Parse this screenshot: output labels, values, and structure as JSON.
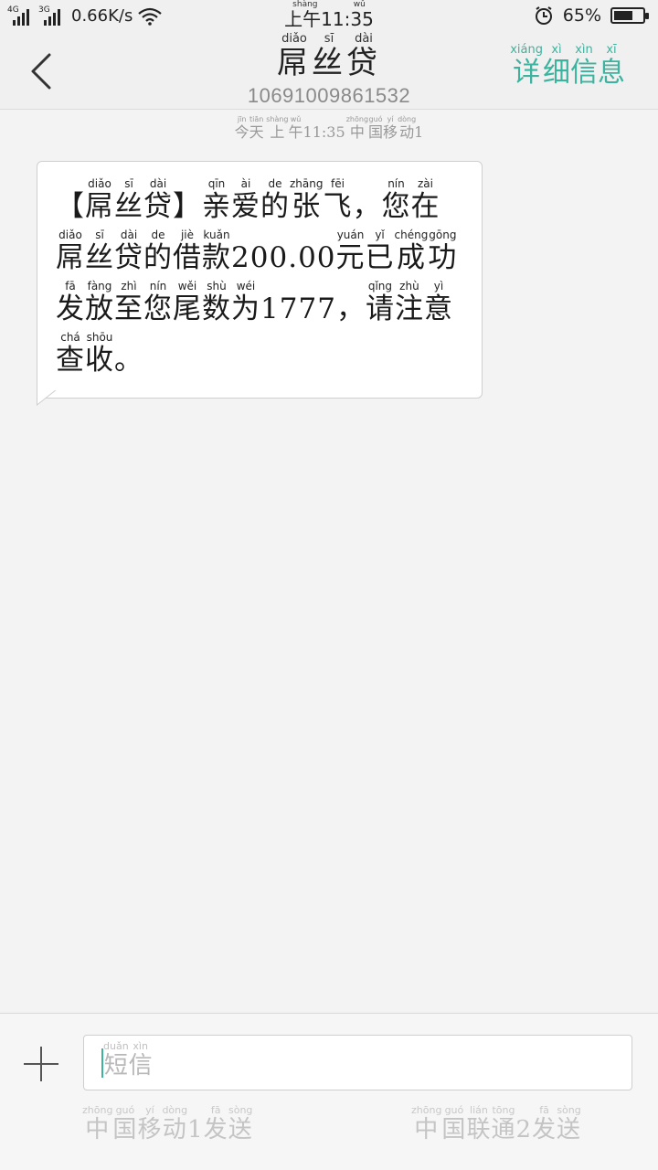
{
  "status_bar": {
    "sim1_tag": "4G",
    "sim2_tag": "3G",
    "speed": "0.66K/s",
    "time": "上午11:35",
    "time_pinyin": "shàng wǔ",
    "battery": "65%",
    "battery_level": 0.65
  },
  "header": {
    "contact_name": [
      "屌",
      "丝",
      "贷"
    ],
    "contact_pinyin": [
      "diǎo",
      "sī",
      "dài"
    ],
    "phone_number": "10691009861532",
    "details": [
      "详",
      "细",
      "信",
      "息"
    ],
    "details_pinyin": [
      "xiáng",
      "xì",
      "xìn",
      "xī"
    ]
  },
  "conversation": {
    "date_chars": [
      "今",
      "天"
    ],
    "date_pinyin": [
      "jīn",
      "tiān"
    ],
    "time_chars": [
      "上",
      "午"
    ],
    "time_pinyin": [
      "shàng",
      "wǔ"
    ],
    "time_value": "11:35",
    "carrier_chars": [
      "中",
      "国",
      "移",
      "动"
    ],
    "carrier_pinyin": [
      "zhōng",
      "guó",
      "yí",
      "dòng"
    ],
    "carrier_suffix": "1"
  },
  "message": {
    "text": "【屌丝贷】亲爱的张飞，您在屌丝贷的借款200.00元已成功发放至您尾数为1777，请注意查收。"
  },
  "compose": {
    "placeholder": [
      "短",
      "信"
    ],
    "placeholder_pinyin": [
      "duǎn",
      "xìn"
    ],
    "send_sim1": "中国移动1发送",
    "send_sim1_pinyin": [
      "zhōng",
      "guó",
      "yí",
      "dòng",
      "",
      "fā",
      "sòng"
    ],
    "send_sim2": "中国联通2发送",
    "send_sim2_pinyin": [
      "zhōng",
      "guó",
      "lián",
      "tōng",
      "",
      "fā",
      "sòng"
    ]
  },
  "colors": {
    "accent": "#3bb39e",
    "background": "#f3f3f3",
    "bubble": "#ffffff"
  }
}
